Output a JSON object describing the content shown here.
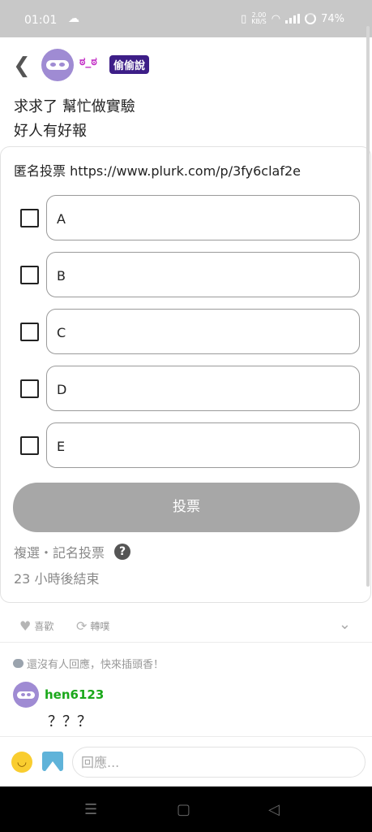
{
  "status_bar": {
    "time": "01:01",
    "cloud_icon": "cloud-icon",
    "net_speed": "2.00",
    "net_unit": "KB/S",
    "battery": "74%"
  },
  "header": {
    "nickname": "ಠ_ಠ",
    "badge": "偷偷說"
  },
  "post": {
    "line1": "求求了 幫忙做實驗",
    "line2": "好人有好報"
  },
  "poll": {
    "title": "匿名投票 https://www.plurk.com/p/3fy6claf2e",
    "options": [
      "A",
      "B",
      "C",
      "D",
      "E"
    ],
    "vote_label": "投票",
    "meta": "複選・記名投票",
    "help_glyph": "?",
    "ends": "23 小時後結束"
  },
  "actions": {
    "like_label": "喜歡",
    "replurk_label": "轉噗"
  },
  "replies": {
    "empty_text": "還沒有人回應，快來插頭香！",
    "items": [
      {
        "user": "hen6123",
        "text": "？？？"
      }
    ]
  },
  "compose": {
    "placeholder": "回應..."
  },
  "colors": {
    "nickname": "#c12ac4",
    "badge_bg": "#3d1e87",
    "avatar": "#9f8bd3",
    "reply_user": "#1aa81a",
    "vote_button": "#a7a7a7"
  }
}
